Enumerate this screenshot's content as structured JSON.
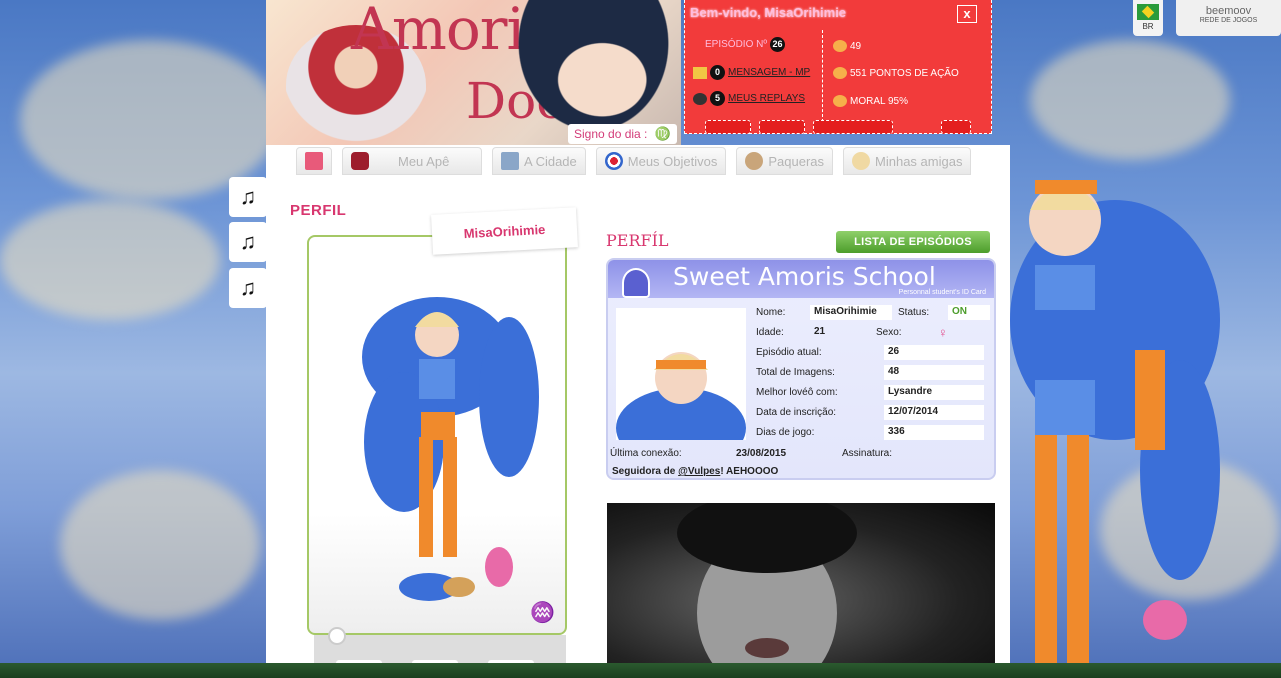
{
  "header": {
    "logo_line1": "Amori",
    "logo_line2": "Doce",
    "signo_label": "Signo do dia :",
    "signo_glyph": "♍"
  },
  "redbox": {
    "title": "Bem-vindo, MisaOrihimie",
    "close_label": "x",
    "episodio_label": "EPISÓDIO Nº",
    "episodio_value": "26",
    "mensagem_count": "0",
    "mensagem_label": "MENSAGEM - MP",
    "replays_count": "5",
    "replays_label": "MEUS REPLAYS",
    "stat1": "49",
    "stat2": "551 PONTOS DE AÇÃO",
    "stat3": "MORAL 95%"
  },
  "topright": {
    "country": "BR",
    "brand": "beemoov",
    "brand_sub": "REDE DE JOGOS"
  },
  "nav": {
    "items": [
      {
        "label": ""
      },
      {
        "label": "Meu Apê"
      },
      {
        "label": "A Cidade"
      },
      {
        "label": "Meus Objetivos"
      },
      {
        "label": "Paqueras"
      },
      {
        "label": "Minhas amigas"
      }
    ]
  },
  "profile": {
    "page_title": "PERFIL",
    "username": "MisaOrihimie",
    "section_title": "PERFÍL",
    "list_button": "LISTA DE EPISÓDIOS"
  },
  "idcard": {
    "title": "Sweet Amoris School",
    "subtitle": "Personnal student's ID Card",
    "nome_label": "Nome:",
    "nome_value": "MisaOrihimie",
    "status_label": "Status:",
    "status_value": "ON",
    "idade_label": "Idade:",
    "idade_value": "21",
    "sexo_label": "Sexo:",
    "sexo_value": "♀",
    "episodio_label": "Episódio atual:",
    "episodio_value": "26",
    "imagens_label": "Total de Imagens:",
    "imagens_value": "48",
    "lovee_label": "Melhor lovéô com:",
    "lovee_value": "Lysandre",
    "inscricao_label": "Data de inscrição:",
    "inscricao_value": "12/07/2014",
    "dias_label": "Dias de jogo:",
    "dias_value": "336",
    "ultima_label": "Última conexão:",
    "ultima_value": "23/08/2015",
    "assinatura_label": "Assinatura:",
    "signature_prefix": "Seguidora de",
    "signature_link": "@Vulpes",
    "signature_suffix": "! AEHOOOO"
  },
  "music": {
    "icon": "♫"
  },
  "colors": {
    "accent_pink": "#d8376f",
    "red_panel": "#f23b3b",
    "green_button": "#4c9d2b",
    "id_blue": "#8e92e8"
  }
}
